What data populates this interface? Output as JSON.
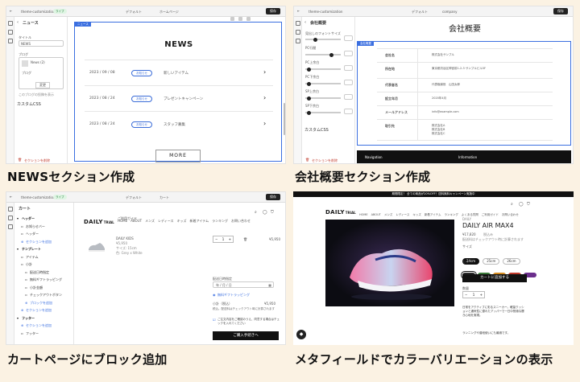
{
  "captions": {
    "p1": "NEWSセクション作成",
    "p2": "会社概要セクション作成",
    "p3": "カートページにブロック追加",
    "p4": "メタフィールドでカラーバリエーションの表示"
  },
  "p1": {
    "store": "theme-customization",
    "live_badge": "ライブ",
    "theme_select": "デフォルト",
    "page_select": "ホームページ",
    "save": "保存",
    "settings_title": "ニュース",
    "field_title_label": "タイトル",
    "field_title_value": "NEWS",
    "block_label": "ブログ",
    "blog_name": "News (2)",
    "blog_sub": "ブログ",
    "change_btn": "変更",
    "hint": "このブログの投稿を表示",
    "custom_css": "カスタムCSS",
    "remove_section": "セクションを削除",
    "section_tag": "ニュース",
    "heading": "NEWS",
    "news": [
      {
        "date": "2023 / 09 / 08",
        "tag": "お知らせ",
        "title": "新しいアイテム"
      },
      {
        "date": "2023 / 08 / 24",
        "tag": "お知らせ",
        "title": "プレゼントキャンペーン"
      },
      {
        "date": "2023 / 08 / 24",
        "tag": "お知らせ",
        "title": "スタッフ募集"
      }
    ],
    "more_button": "MORE"
  },
  "p2": {
    "store": "theme-customization",
    "theme_select": "デフォルト",
    "page_select": "company",
    "save": "保存",
    "settings_title": "会社概要",
    "settings_first": "見出しのフォントサイズ",
    "settings_rows": [
      "PC行間",
      "PC上余白",
      "PC下余白",
      "SP上余白",
      "SP下余白"
    ],
    "custom_css": "カスタムCSS",
    "remove_section": "セクションを削除",
    "section_tag": "会社概要",
    "heading": "会社概要",
    "table": [
      {
        "label": "会社名",
        "value": "株式会社サンプル"
      },
      {
        "label": "所在地",
        "value": "東京都渋谷区神宮前1-2-3 サンプルビル5F"
      },
      {
        "label": "代表者名",
        "value": "代表取締役　山田太郎"
      },
      {
        "label": "設立年月",
        "value": "2020年4月"
      },
      {
        "label": "メールアドレス",
        "value": "info@example.com"
      },
      {
        "label": "取引先",
        "value": "株式会社A\n株式会社B\n株式会社C"
      }
    ],
    "footer_nav": "Navigation",
    "footer_info": "Information"
  },
  "p3": {
    "store": "theme-customization",
    "live_badge": "ライブ",
    "theme_select": "デフォルト",
    "page_select": "カート",
    "save": "保存",
    "sidebar_title": "カート",
    "tree": [
      {
        "label": "ヘッダー",
        "indent": 0,
        "kind": "group"
      },
      {
        "label": "お知らせバー",
        "indent": 1,
        "kind": "item"
      },
      {
        "label": "ヘッダー",
        "indent": 1,
        "kind": "item"
      },
      {
        "label": "セクションを追加",
        "indent": 1,
        "kind": "add"
      },
      {
        "label": "テンプレート",
        "indent": 0,
        "kind": "group"
      },
      {
        "label": "アイテム",
        "indent": 1,
        "kind": "item"
      },
      {
        "label": "小計",
        "indent": 1,
        "kind": "item"
      },
      {
        "label": "配送日時指定",
        "indent": 2,
        "kind": "item"
      },
      {
        "label": "無料ギフトラッピング",
        "indent": 2,
        "kind": "item"
      },
      {
        "label": "小計金額",
        "indent": 2,
        "kind": "item"
      },
      {
        "label": "チェックアウトボタン",
        "indent": 2,
        "kind": "item"
      },
      {
        "label": "ブロックを追加",
        "indent": 2,
        "kind": "add"
      },
      {
        "label": "セクションを追加",
        "indent": 1,
        "kind": "add"
      },
      {
        "label": "フッター",
        "indent": 0,
        "kind": "group"
      },
      {
        "label": "セクションを追加",
        "indent": 1,
        "kind": "add"
      },
      {
        "label": "フッター",
        "indent": 1,
        "kind": "item"
      }
    ],
    "logo_main": "DAILY",
    "logo_sub": "TRIAL",
    "nav": [
      "HOME",
      "ABOUT",
      "メンズ",
      "レディース",
      "キッズ",
      "新着アイテム",
      "ランキング",
      "お問い合わせ"
    ],
    "subnav": "ご利用ガイド",
    "cart_item_name": "DAILY KIDS",
    "cart_item_meta1": "¥5,950",
    "cart_item_meta2": "サイズ: 15cm",
    "cart_item_meta3": "色: Grey x White",
    "qty": "1",
    "price": "¥5,950",
    "delivery_label": "配送日時指定",
    "delivery_date": "年 / 月 / 日",
    "gift_label": "無料ギフトラッピング",
    "subtotal_label": "小計（税込）",
    "subtotal_value": "¥5,950",
    "tax_note": "税込。配送料はチェックアウト時に計算されます",
    "agree_note": "ご注文内容をご確認のうえ、同意する場合はチェックを入れてください",
    "checkout": "ご購入手続きへ"
  },
  "p4": {
    "announcement": "期間限定！ 全ての商品が20%OFF！送料無料キャンペーン実施中",
    "logo_main": "DAILY",
    "logo_sub": "TRIAL",
    "nav": [
      "HOME",
      "ABOUT",
      "メンズ",
      "レディース",
      "キッズ",
      "新着アイテム",
      "ランキング",
      "よくある質問",
      "ご利用ガイド",
      "お問い合わせ"
    ],
    "product_title": "DAILY AIR MAX4",
    "price": "¥17,820",
    "price_note": "税込み",
    "shipping_note": "配送料はチェックアウト時に計算されます",
    "size_label": "サイズ",
    "sizes": [
      "24cm",
      "25cm",
      "26cm"
    ],
    "color_label": "カラー",
    "colors": [
      "#2a2a2a",
      "#3b7a3a",
      "#d48a1e",
      "#c0392b",
      "#6b2e8c"
    ],
    "qty_label": "数量",
    "qty": "1",
    "add_to_cart": "カートに追加する",
    "description": "日常をアクティブに彩るスニーカー。軽量クッションと通気性に優れたアッパーで一日中快適な履き心地を実現。",
    "description2": "ランニングや普段使いにも最適です。"
  }
}
